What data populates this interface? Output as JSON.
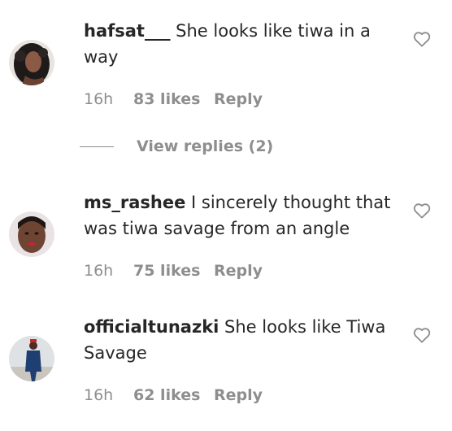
{
  "comments": [
    {
      "username": "hafsat___",
      "text": "She looks like tiwa in a way",
      "time": "16h",
      "likes": "83 likes",
      "reply_label": "Reply",
      "avatar_icon": "avatar-woman-curly-hair",
      "view_replies": "View replies (2)"
    },
    {
      "username": "ms_rashee",
      "text": "I sincerely thought that was tiwa savage from an angle",
      "time": "16h",
      "likes": "75 likes",
      "reply_label": "Reply",
      "avatar_icon": "avatar-woman-selfie"
    },
    {
      "username": "officialtunazki",
      "text": "She looks like Tiwa Savage",
      "time": "16h",
      "likes": "62 likes",
      "reply_label": "Reply",
      "avatar_icon": "avatar-man-standing"
    }
  ],
  "colors": {
    "text": "#262626",
    "muted": "#8e8e8e",
    "background": "#ffffff"
  },
  "icons": {
    "like": "heart-outline-icon"
  }
}
